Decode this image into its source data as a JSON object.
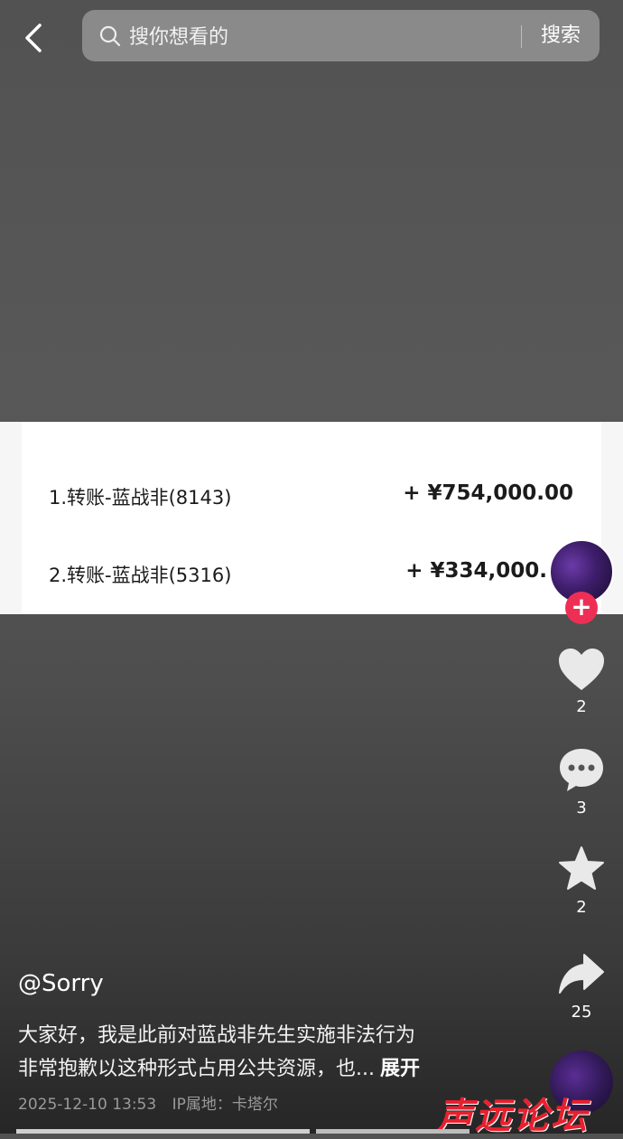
{
  "search": {
    "placeholder": "搜你想看的",
    "button": "搜索"
  },
  "transactions": [
    {
      "desc": "1.转账-蓝战非(8143)",
      "amount": "+ ¥754,000.00"
    },
    {
      "desc": "2.转账-蓝战非(5316)",
      "amount": "+ ¥334,000."
    }
  ],
  "actions": {
    "like_count": "2",
    "comment_count": "3",
    "favorite_count": "2",
    "share_count": "25"
  },
  "post": {
    "author": "@Sorry",
    "caption_line1": "大家好，我是此前对蓝战非先生实施非法行为",
    "caption_line2": "非常抱歉以这种形式占用公共资源，也...",
    "expand": "展开",
    "date": "2025-12-10 13:53",
    "ip_location": "IP属地：卡塔尔"
  },
  "watermark": "声远论坛",
  "icons": [
    "back-icon",
    "search-icon",
    "heart-icon",
    "comment-icon",
    "star-icon",
    "share-icon",
    "plus-icon"
  ]
}
